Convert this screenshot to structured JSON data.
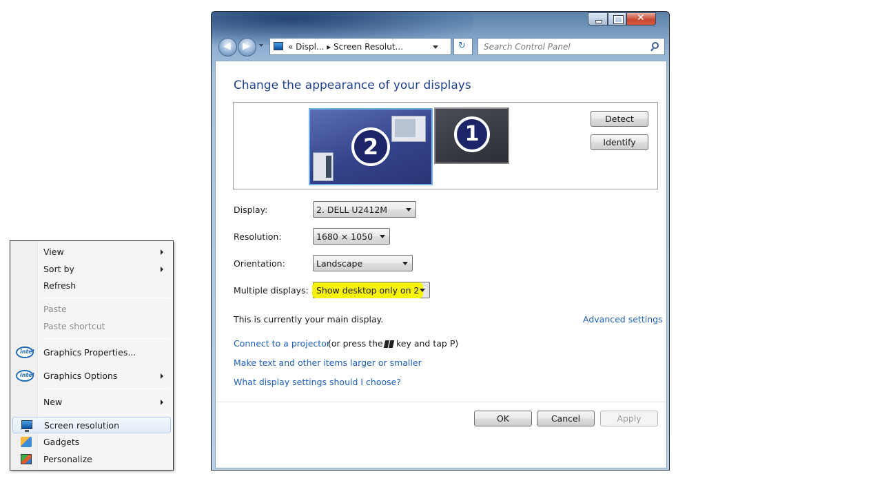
{
  "context_menu": {
    "items": [
      {
        "label": "View"
      },
      {
        "label": "Sort by"
      },
      {
        "label": "Refresh"
      },
      {
        "label": "Paste"
      },
      {
        "label": "Paste shortcut"
      },
      {
        "label": "Graphics Properties..."
      },
      {
        "label": "Graphics Options"
      },
      {
        "label": "New"
      },
      {
        "label": "Screen resolution"
      },
      {
        "label": "Gadgets"
      },
      {
        "label": "Personalize"
      }
    ],
    "intel_icon_text": "intel"
  },
  "window": {
    "controls": {
      "close_glyph": "✕"
    },
    "nav": {
      "back_glyph": "◀",
      "forward_glyph": "▶"
    },
    "address": {
      "crumbs": "«  Displ...  ▸  Screen Resolut..."
    },
    "refresh_glyph": "↻",
    "search": {
      "placeholder": "Search Control Panel"
    },
    "title": "Change the appearance of your displays",
    "monitors": [
      {
        "number": "2"
      },
      {
        "number": "1"
      }
    ],
    "buttons": {
      "detect": "Detect",
      "identify": "Identify"
    },
    "settings": {
      "display_label": "Display:",
      "display_value": "2. DELL U2412M",
      "resolution_label": "Resolution:",
      "resolution_value": "1680 × 1050",
      "orientation_label": "Orientation:",
      "orientation_value": "Landscape",
      "multiple_label": "Multiple displays:",
      "multiple_value": "Show desktop only on 2"
    },
    "main_display_text": "This is currently your main display.",
    "advanced_link": "Advanced settings",
    "links": {
      "projector": "Connect to a projector",
      "projector_suffix_1": "(or press the",
      "projector_suffix_2": "key and tap P)",
      "text_size": "Make text and other items larger or smaller",
      "which_settings": "What display settings should I choose?"
    },
    "dialog_buttons": {
      "ok": "OK",
      "cancel": "Cancel",
      "apply": "Apply"
    }
  }
}
